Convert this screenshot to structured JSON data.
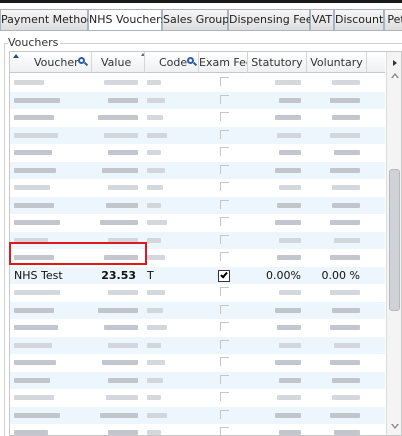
{
  "tabs": [
    {
      "label": "Payment Methods",
      "active": false
    },
    {
      "label": "NHS Vouchers",
      "active": true
    },
    {
      "label": "Sales Groups",
      "active": false
    },
    {
      "label": "Dispensing Fees",
      "active": false
    },
    {
      "label": "VAT",
      "active": false
    },
    {
      "label": "Discounts",
      "active": false
    },
    {
      "label": "Pet",
      "active": false
    }
  ],
  "group": {
    "title": "Vouchers"
  },
  "columns": {
    "voucher": "Voucher",
    "value": "Value",
    "code": "Code",
    "exam_fee": "Exam Fee",
    "statutory": "Statutory",
    "voluntary": "Voluntary"
  },
  "highlighted_row": {
    "voucher": "NHS Test",
    "value": "23.53",
    "code": "T",
    "exam_fee_checked": true,
    "statutory": "0.00%",
    "voluntary": "0.00 %"
  },
  "highlight_color": "#e0181e",
  "icons": {
    "column_search": "search-icon",
    "sort": "sort-arrow-icon",
    "scroll_right": "chevron-right-icon",
    "scroll_up": "chevron-up-icon",
    "scroll_down": "chevron-down-icon"
  }
}
